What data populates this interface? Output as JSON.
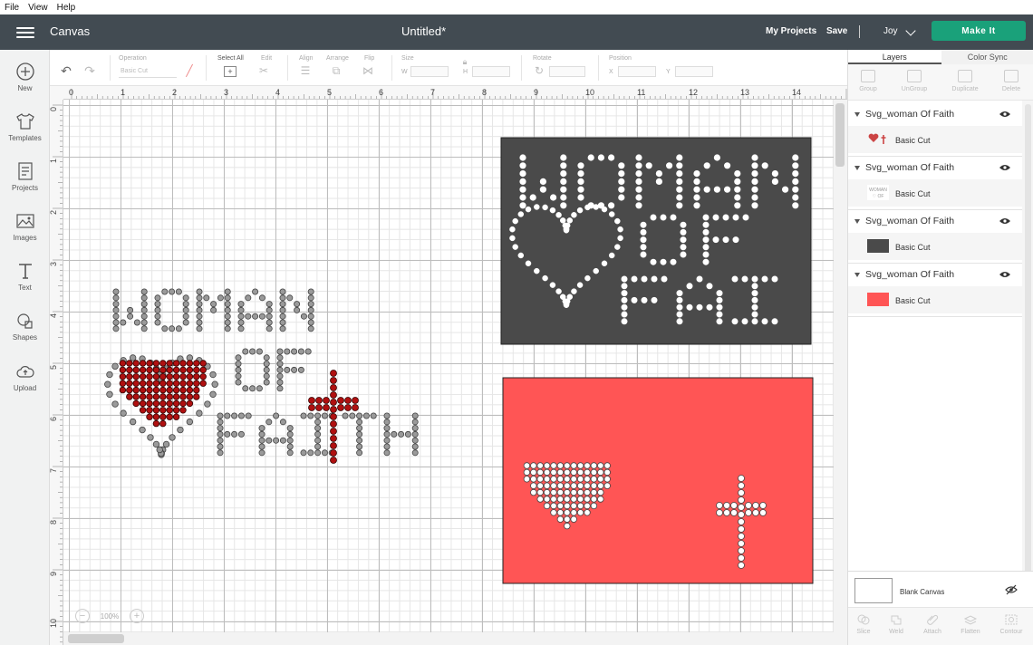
{
  "menu": [
    "File",
    "View",
    "Help"
  ],
  "header": {
    "app_title": "Canvas",
    "doc_title": "Untitled*",
    "my_projects": "My Projects",
    "save": "Save",
    "user": "Joy",
    "make_it": "Make It"
  },
  "leftbar": [
    {
      "label": "New",
      "icon": "plus-circle-icon"
    },
    {
      "label": "Templates",
      "icon": "tshirt-icon"
    },
    {
      "label": "Projects",
      "icon": "projects-icon"
    },
    {
      "label": "Images",
      "icon": "image-icon"
    },
    {
      "label": "Text",
      "icon": "text-icon"
    },
    {
      "label": "Shapes",
      "icon": "shapes-icon"
    },
    {
      "label": "Upload",
      "icon": "upload-cloud-icon"
    }
  ],
  "toolbar": {
    "operation_label": "Operation",
    "operation_value": "Basic Cut",
    "select_all": "Select All",
    "edit": "Edit",
    "align": "Align",
    "arrange": "Arrange",
    "flip": "Flip",
    "size": "Size",
    "size_w": "W",
    "size_h": "H",
    "rotate": "Rotate",
    "position": "Position",
    "pos_x": "X",
    "pos_y": "Y"
  },
  "rulers": {
    "top": [
      "0",
      "1",
      "2",
      "3",
      "4",
      "5",
      "6",
      "7",
      "8",
      "9",
      "10",
      "11",
      "12",
      "13",
      "14"
    ],
    "left": [
      "0",
      "1",
      "2",
      "3",
      "4",
      "5",
      "6",
      "7",
      "8",
      "9",
      "10"
    ]
  },
  "zoom": {
    "value": "100%"
  },
  "artwork": {
    "text_line1": "WOMAN",
    "text_line2": "OF",
    "text_line3": "FAITH",
    "panel_line3": "FAI H",
    "colors": {
      "rhinestone_gray": "#9a9a9a",
      "rhinestone_red": "#b01010",
      "dark_panel": "#4a4a4a",
      "red_panel": "#ff5555"
    }
  },
  "panel": {
    "tabs": [
      "Layers",
      "Color Sync"
    ],
    "tools": [
      "Group",
      "UnGroup",
      "Duplicate",
      "Delete"
    ],
    "layers": [
      {
        "name": "Svg_woman Of Faith",
        "sub": "Basic Cut",
        "thumb": "heart-cross"
      },
      {
        "name": "Svg_woman Of Faith",
        "sub": "Basic Cut",
        "thumb": "text-white"
      },
      {
        "name": "Svg_woman Of Faith",
        "sub": "Basic Cut",
        "thumb": "dark-rect",
        "color": "#4a4a4a"
      },
      {
        "name": "Svg_woman Of Faith",
        "sub": "Basic Cut",
        "thumb": "red-rect",
        "color": "#ff5555"
      }
    ],
    "blank_canvas": "Blank Canvas",
    "bottom_tools": [
      "Slice",
      "Weld",
      "Attach",
      "Flatten",
      "Contour"
    ]
  }
}
